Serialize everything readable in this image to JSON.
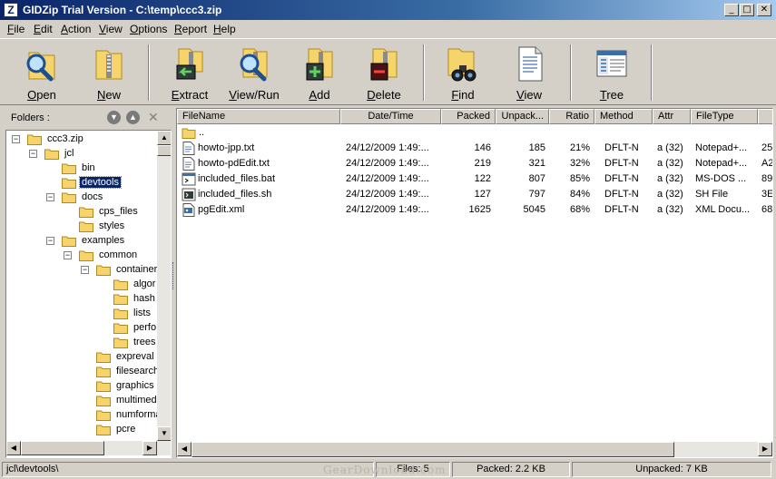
{
  "window": {
    "title": "GIDZip Trial Version - C:\\temp\\ccc3.zip"
  },
  "menu": [
    "File",
    "Edit",
    "Action",
    "View",
    "Options",
    "Report",
    "Help"
  ],
  "toolbar": [
    {
      "label": "Open",
      "icon": "open-folder-magnifier-icon"
    },
    {
      "label": "New",
      "icon": "new-archive-icon"
    },
    {
      "label": "Extract",
      "icon": "extract-icon"
    },
    {
      "label": "View/Run",
      "icon": "view-run-icon"
    },
    {
      "label": "Add",
      "icon": "add-icon"
    },
    {
      "label": "Delete",
      "icon": "delete-icon"
    },
    {
      "label": "Find",
      "icon": "find-binoculars-icon"
    },
    {
      "label": "View",
      "icon": "view-document-icon"
    },
    {
      "label": "Tree",
      "icon": "tree-window-icon"
    }
  ],
  "folders": {
    "label": "Folders :",
    "tree": [
      {
        "label": "ccc3.zip",
        "level": 0,
        "expanded": true
      },
      {
        "label": "jcl",
        "level": 1,
        "expanded": true
      },
      {
        "label": "bin",
        "level": 2
      },
      {
        "label": "devtools",
        "level": 2,
        "selected": true
      },
      {
        "label": "docs",
        "level": 2,
        "expanded": true
      },
      {
        "label": "cps_files",
        "level": 3
      },
      {
        "label": "styles",
        "level": 3
      },
      {
        "label": "examples",
        "level": 2,
        "expanded": true
      },
      {
        "label": "common",
        "level": 3,
        "expanded": true
      },
      {
        "label": "container",
        "level": 4,
        "expanded": true
      },
      {
        "label": "algor",
        "level": 5
      },
      {
        "label": "hash",
        "level": 5
      },
      {
        "label": "lists",
        "level": 5
      },
      {
        "label": "perfo",
        "level": 5
      },
      {
        "label": "trees",
        "level": 5
      },
      {
        "label": "expreval",
        "level": 4
      },
      {
        "label": "filesearch",
        "level": 4
      },
      {
        "label": "graphics",
        "level": 4
      },
      {
        "label": "multimedi",
        "level": 4
      },
      {
        "label": "numforma",
        "level": 4
      },
      {
        "label": "pcre",
        "level": 4
      }
    ]
  },
  "filelist": {
    "columns": [
      "FileName",
      "Date/Time",
      "Packed",
      "Unpack...",
      "Ratio",
      "Method",
      "Attr",
      "FileType"
    ],
    "parent": "..",
    "rows": [
      {
        "name": "howto-jpp.txt",
        "date": "24/12/2009 1:49:...",
        "packed": "146",
        "unpacked": "185",
        "ratio": "21%",
        "method": "DFLT-N",
        "attr": "a (32)",
        "type": "Notepad+...",
        "extra": "25",
        "icon": "text-file-icon"
      },
      {
        "name": "howto-pdEdit.txt",
        "date": "24/12/2009 1:49:...",
        "packed": "219",
        "unpacked": "321",
        "ratio": "32%",
        "method": "DFLT-N",
        "attr": "a (32)",
        "type": "Notepad+...",
        "extra": "A2",
        "icon": "text-file-icon"
      },
      {
        "name": "included_files.bat",
        "date": "24/12/2009 1:49:...",
        "packed": "122",
        "unpacked": "807",
        "ratio": "85%",
        "method": "DFLT-N",
        "attr": "a (32)",
        "type": "MS-DOS ...",
        "extra": "89",
        "icon": "batch-file-icon"
      },
      {
        "name": "included_files.sh",
        "date": "24/12/2009 1:49:...",
        "packed": "127",
        "unpacked": "797",
        "ratio": "84%",
        "method": "DFLT-N",
        "attr": "a (32)",
        "type": "SH File",
        "extra": "3E",
        "icon": "script-file-icon"
      },
      {
        "name": "pgEdit.xml",
        "date": "24/12/2009 1:49:...",
        "packed": "1625",
        "unpacked": "5045",
        "ratio": "68%",
        "method": "DFLT-N",
        "attr": "a (32)",
        "type": "XML Docu...",
        "extra": "68",
        "icon": "xml-file-icon"
      }
    ]
  },
  "status": {
    "path": "jcl\\devtools\\",
    "files": "Files: 5",
    "packed": "Packed: 2.2 KB",
    "unpacked": "Unpacked: 7 KB"
  },
  "watermark": "GearDownload.com",
  "colors": {
    "titlebar": "#0a246a",
    "folder": "#f5d56b",
    "selection": "#0a246a"
  }
}
